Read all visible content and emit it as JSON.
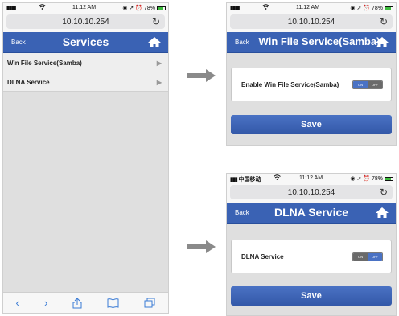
{
  "left_screen": {
    "status": {
      "time": "11:12 AM",
      "battery": "78%"
    },
    "url": "10.10.10.254",
    "nav": {
      "back": "Back",
      "title": "Services"
    },
    "items": [
      {
        "label": "Win File Service(Samba)"
      },
      {
        "label": "DLNA Service"
      }
    ]
  },
  "top_right_screen": {
    "status": {
      "time": "11:12 AM",
      "battery": "78%"
    },
    "url": "10.10.10.254",
    "nav": {
      "back": "Back",
      "title": "Win File Service(Samba)"
    },
    "setting_label": "Enable Win File Service(Samba)",
    "toggle": {
      "on": "ON",
      "off": "OFF",
      "selected": "on"
    },
    "save": "Save"
  },
  "bottom_right_screen": {
    "status": {
      "carrier": "中国移动",
      "time": "11:12 AM",
      "battery": "78%"
    },
    "url": "10.10.10.254",
    "nav": {
      "back": "Back",
      "title": "DLNA Service"
    },
    "setting_label": "DLNA Service",
    "toggle": {
      "on": "ON",
      "off": "OFF",
      "selected": "off"
    },
    "save": "Save"
  },
  "colors": {
    "nav": "#3a62b4",
    "toggle_active": "#4a72c4",
    "toggle_inactive": "#6a6a6a",
    "battery": "#3dbb3d"
  },
  "battery_level": 0.78
}
